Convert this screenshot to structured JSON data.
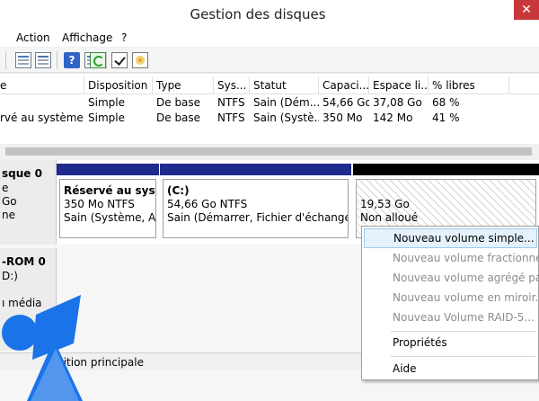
{
  "window": {
    "title": "Gestion des disques",
    "close_glyph": "✕"
  },
  "menu": {
    "action": "Action",
    "affichage": "Affichage",
    "help": "?"
  },
  "toolbar": {
    "help_glyph": "?"
  },
  "volume_list": {
    "columns": [
      "e",
      "Disposition",
      "Type",
      "Sys...",
      "Statut",
      "Capaci...",
      "Espace li...",
      "% libres"
    ],
    "rows": [
      [
        "",
        "Simple",
        "De base",
        "NTFS",
        "Sain (Dém...",
        "54,66 Go",
        "37,08 Go",
        "68 %"
      ],
      [
        "rvé au système",
        "Simple",
        "De base",
        "NTFS",
        "Sain (Systè...",
        "350 Mo",
        "142 Mo",
        "41 %"
      ]
    ]
  },
  "disks": {
    "disk0": {
      "label_name": "sque 0",
      "label_type": "e",
      "label_size": "Go",
      "label_status": "ne",
      "partitions": [
        {
          "name": "Réservé au systèn",
          "size": "350 Mo NTFS",
          "status": "Sain (Système, Acti"
        },
        {
          "name": "(C:)",
          "size": "54,66 Go NTFS",
          "status": "Sain (Démarrer, Fichier d'échange, Vic"
        },
        {
          "size": "19,53 Go",
          "status": "Non alloué"
        }
      ],
      "colors": {
        "primary": "#1e2a8c",
        "unallocated": "#000000"
      }
    },
    "cdrom": {
      "label_name": "-ROM 0",
      "label_drive": "D:)",
      "label_status": "ı média"
    }
  },
  "legend": {
    "text": "tition principale"
  },
  "context_menu": {
    "items": [
      {
        "label": "Nouveau volume simple...",
        "enabled": true
      },
      {
        "label": "Nouveau volume fractionné...",
        "enabled": false
      },
      {
        "label": "Nouveau volume agrégé par ba",
        "enabled": false
      },
      {
        "label": "Nouveau volume en miroir...",
        "enabled": false
      },
      {
        "label": "Nouveau Volume RAID-5...",
        "enabled": false
      },
      {
        "label": "Propriétés",
        "enabled": true
      },
      {
        "label": "Aide",
        "enabled": true
      }
    ]
  },
  "colors": {
    "accent": "#1e2a8c",
    "watermark": "#1a73e8"
  }
}
